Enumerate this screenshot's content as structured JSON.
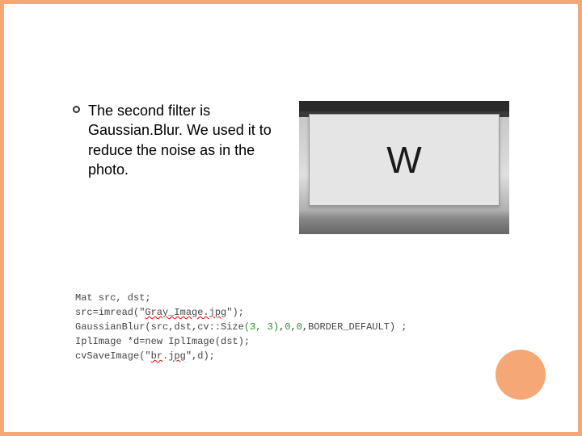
{
  "paragraph": "The second filter is Gaussian.Blur. We used it to reduce the noise as in the photo.",
  "photo": {
    "letter": "W"
  },
  "code": {
    "line1_a": "Mat src, dst;",
    "line2_a": "src=imread(\"",
    "line2_b": "Gray_Image.",
    "line2_c": "jpg",
    "line2_d": "\");",
    "line3_a": "GaussianBlur(src,dst,cv::Size",
    "line3_b": "(3, 3)",
    "line3_c": ",",
    "line3_d": "0",
    "line3_e": ",",
    "line3_f": "0",
    "line3_g": ",BORDER_DEFAULT) ;",
    "line4_a": "IplImage *d=new IplImage(dst);",
    "line5_a": "cvSaveImage(\"",
    "line5_b": "br",
    "line5_c": ".",
    "line5_d": "jpg",
    "line5_e": "\",d);"
  }
}
